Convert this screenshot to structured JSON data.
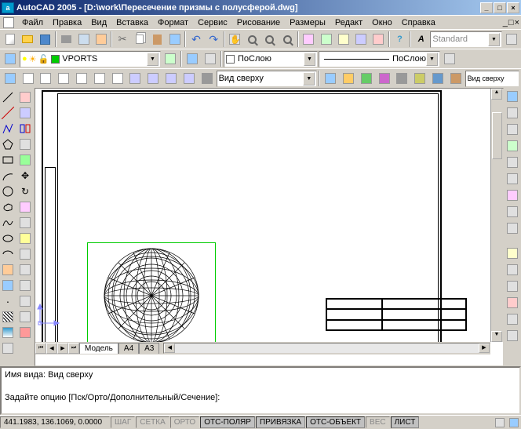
{
  "title": "AutoCAD 2005 - [D:\\work\\Пересечение призмы с полусферой.dwg]",
  "menu": [
    "Файл",
    "Правка",
    "Вид",
    "Вставка",
    "Формат",
    "Сервис",
    "Рисование",
    "Размеры",
    "Редакт",
    "Окно",
    "Справка"
  ],
  "layer_dropdown": "VPORTS",
  "text_style": "Standard",
  "color_dropdown": "ПоСлою",
  "linetype_dropdown": "ПоСлою",
  "view_dropdown": "Вид сверху",
  "view_dropdown2": "Вид сверху",
  "tabs": {
    "model": "Модель",
    "a4": "A4",
    "a3": "A3"
  },
  "command": {
    "line1": "Имя вида: Вид сверху",
    "line2": "Задайте опцию [Пск/Орто/Дополнительный/Сечение]:"
  },
  "status": {
    "coords": "441.1983, 136.1069, 0.0000",
    "buttons": [
      "ШАГ",
      "СЕТКА",
      "ОРТО",
      "ОТС-ПОЛЯР",
      "ПРИВЯЗКА",
      "ОТС-ОБЪЕКТ",
      "ВЕС",
      "ЛИСТ"
    ]
  },
  "win_btns": {
    "min": "_",
    "max": "□",
    "close": "×"
  }
}
